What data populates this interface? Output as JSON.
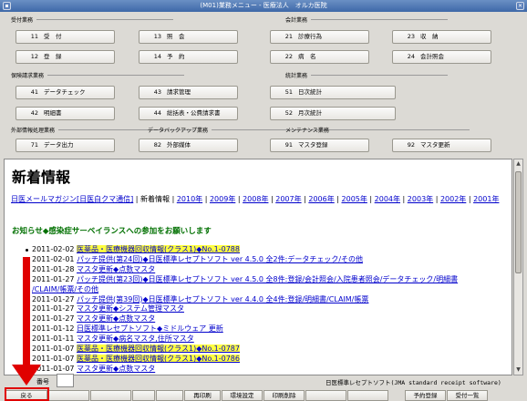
{
  "window": {
    "title": "(M01)業務メニュー - 医療法人　オルカ医院"
  },
  "groups": {
    "reception": "受付業務",
    "accounting": "会計業務",
    "claim": "保険請求業務",
    "stats": "統計業務",
    "external": "外部情報処理業務",
    "backup": "データバックアップ業務",
    "maintenance": "メンテナンス業務"
  },
  "menu": {
    "b11": {
      "num": "11",
      "label": "受　付"
    },
    "b13": {
      "num": "13",
      "label": "照　会"
    },
    "b21": {
      "num": "21",
      "label": "診療行為"
    },
    "b23": {
      "num": "23",
      "label": "収　納"
    },
    "b12": {
      "num": "12",
      "label": "登　録"
    },
    "b14": {
      "num": "14",
      "label": "予　約"
    },
    "b22": {
      "num": "22",
      "label": "病　名"
    },
    "b24": {
      "num": "24",
      "label": "会計照会"
    },
    "b41": {
      "num": "41",
      "label": "データチェック"
    },
    "b43": {
      "num": "43",
      "label": "請求管理"
    },
    "b51": {
      "num": "51",
      "label": "日次統計"
    },
    "b42": {
      "num": "42",
      "label": "明細書"
    },
    "b44": {
      "num": "44",
      "label": "総括表・公費請求書"
    },
    "b52": {
      "num": "52",
      "label": "月次統計"
    },
    "b71": {
      "num": "71",
      "label": "データ出力"
    },
    "b82": {
      "num": "82",
      "label": "外部媒体"
    },
    "b91": {
      "num": "91",
      "label": "マスタ登録"
    },
    "b92": {
      "num": "92",
      "label": "マスタ更新"
    }
  },
  "news": {
    "heading": "新着情報",
    "year_links": [
      {
        "text": "日医メールマガジン[日医白クマ通信]",
        "link": true
      },
      {
        "text": " | 新着情報 | ",
        "link": false
      },
      {
        "text": "2010年",
        "link": true
      },
      {
        "text": " | ",
        "link": false
      },
      {
        "text": "2009年",
        "link": true
      },
      {
        "text": " | ",
        "link": false
      },
      {
        "text": "2008年",
        "link": true
      },
      {
        "text": " | ",
        "link": false
      },
      {
        "text": "2007年",
        "link": true
      },
      {
        "text": " | ",
        "link": false
      },
      {
        "text": "2006年",
        "link": true
      },
      {
        "text": " | ",
        "link": false
      },
      {
        "text": "2005年",
        "link": true
      },
      {
        "text": " | ",
        "link": false
      },
      {
        "text": "2004年",
        "link": true
      },
      {
        "text": " | ",
        "link": false
      },
      {
        "text": "2003年",
        "link": true
      },
      {
        "text": " | ",
        "link": false
      },
      {
        "text": "2002年",
        "link": true
      },
      {
        "text": " | ",
        "link": false
      },
      {
        "text": "2001年",
        "link": true
      }
    ],
    "notice": "お知らせ◆感染症サーベイランスへの参加をお願いします",
    "items": [
      {
        "date": "2011-02-02",
        "text": "医薬品・医療機器回収情報(クラス1)◆No.1-0788",
        "style": "hl"
      },
      {
        "date": "2011-02-01",
        "text": "パッチ提供(第24回)◆日医標準レセプトソフト ver 4.5.0 全2件:データチェック/その他",
        "style": "link"
      },
      {
        "date": "2011-01-28",
        "text": "マスタ更新◆点数マスタ",
        "style": "red"
      },
      {
        "date": "2011-01-27",
        "text": "パッチ提供(第23回)◆日医標準レセプトソフト ver 4.5.0 全8件:登録/会計照会/入院患者照会/データチェック/明細書",
        "style": "link"
      },
      {
        "date": "",
        "text": "/CLAIM/帳票/その他",
        "style": "link"
      },
      {
        "date": "2011-01-27",
        "text": "パッチ提供(第39回)◆日医標準レセプトソフト ver 4.4.0 全4件:登録/明細書/CLAIM/帳票",
        "style": "link"
      },
      {
        "date": "2011-01-27",
        "text": "マスタ更新◆システム管理マスタ",
        "style": "red"
      },
      {
        "date": "2011-01-27",
        "text": "マスタ更新◆点数マスタ",
        "style": "red"
      },
      {
        "date": "2011-01-12",
        "text": "日医標準レセプトソフト◆ミドルウェア 更新",
        "style": "link"
      },
      {
        "date": "2011-01-11",
        "text": "マスタ更新◆病名マスタ,住所マスタ",
        "style": "red"
      },
      {
        "date": "2011-01-07",
        "text": "医薬品・医療機器回収情報(クラス1)◆No.1-0787",
        "style": "hl"
      },
      {
        "date": "2011-01-07",
        "text": "医薬品・医療機器回収情報(クラス1)◆No.1-0786",
        "style": "hl"
      },
      {
        "date": "2011-01-07",
        "text": "マスタ更新◆点数マスタ",
        "style": "red"
      }
    ]
  },
  "status": {
    "label": "番号",
    "software": "日医標準レセプトソフト(JMA standard receipt software)"
  },
  "fkeys": {
    "f1": "戻る",
    "f2": "",
    "f3": "",
    "f4": "",
    "f5": "",
    "f6": "再印刷",
    "f7": "環境設定",
    "f8": "印刷削除",
    "f9": "",
    "f10": "",
    "f11": "予約登録",
    "f12": "受付一覧"
  }
}
